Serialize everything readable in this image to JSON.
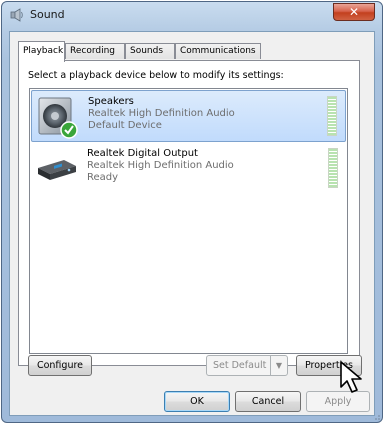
{
  "window": {
    "title": "Sound"
  },
  "tabs": [
    {
      "label": "Playback"
    },
    {
      "label": "Recording"
    },
    {
      "label": "Sounds"
    },
    {
      "label": "Communications"
    }
  ],
  "playback": {
    "instruction": "Select a playback device below to modify its settings:",
    "devices": [
      {
        "name": "Speakers",
        "driver": "Realtek High Definition Audio",
        "status": "Default Device",
        "icon": "speaker-icon",
        "is_default": true,
        "selected": true
      },
      {
        "name": "Realtek Digital Output",
        "driver": "Realtek High Definition Audio",
        "status": "Ready",
        "icon": "digital-output-icon",
        "is_default": false,
        "selected": false
      }
    ],
    "buttons": {
      "configure": "Configure",
      "set_default": "Set Default",
      "properties": "Properties"
    }
  },
  "footer": {
    "ok": "OK",
    "cancel": "Cancel",
    "apply": "Apply"
  },
  "colors": {
    "selection": "#c1dbfc",
    "close_button": "#c3401e",
    "level_meter": "#b8e3b0",
    "default_check": "#3aa53a"
  }
}
